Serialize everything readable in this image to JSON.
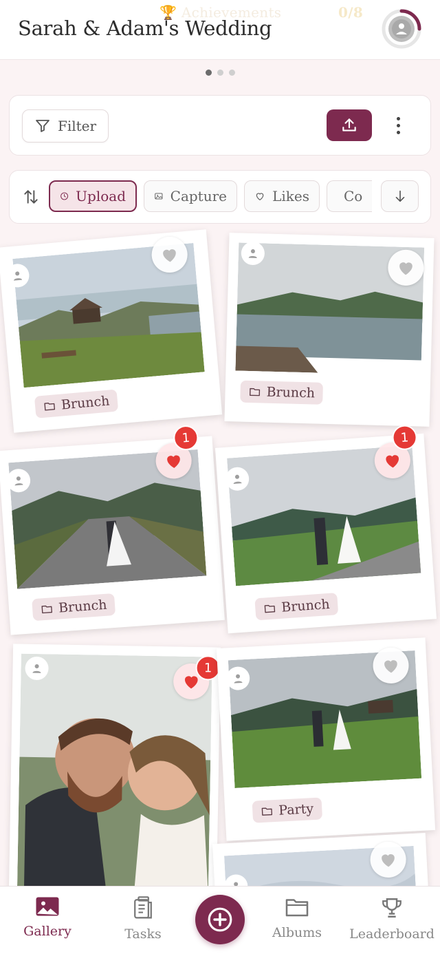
{
  "header": {
    "ghost_label": "Achievements",
    "ghost_count": "0/8",
    "title": "Sarah & Adam's Wedding",
    "progress": 0.12
  },
  "pager": {
    "count": 3,
    "active": 0
  },
  "toolbar": {
    "filter_label": "Filter",
    "upload_icon": "upload-icon",
    "more_icon": "more-vertical-icon"
  },
  "sort": {
    "options": [
      {
        "label": "Upload",
        "icon": "clock-icon",
        "selected": true
      },
      {
        "label": "Capture",
        "icon": "image-icon",
        "selected": false
      },
      {
        "label": "Likes",
        "icon": "heart-outline-icon",
        "selected": false
      },
      {
        "label": "Co",
        "icon": "comment-icon",
        "selected": false
      }
    ]
  },
  "photos": [
    {
      "album": "Brunch",
      "liked": false,
      "likes": ""
    },
    {
      "album": "Brunch",
      "liked": false,
      "likes": ""
    },
    {
      "album": "Brunch",
      "liked": true,
      "likes": "1"
    },
    {
      "album": "Brunch",
      "liked": true,
      "likes": "1"
    },
    {
      "album": "",
      "liked": true,
      "likes": "1"
    },
    {
      "album": "Party",
      "liked": false,
      "likes": ""
    },
    {
      "album": "",
      "liked": false,
      "likes": ""
    }
  ],
  "nav": {
    "gallery": "Gallery",
    "tasks": "Tasks",
    "albums": "Albums",
    "leaderboard": "Leaderboard"
  },
  "colors": {
    "accent": "#7d2a4f",
    "badge": "#e53935",
    "background": "#fbf3f4"
  }
}
